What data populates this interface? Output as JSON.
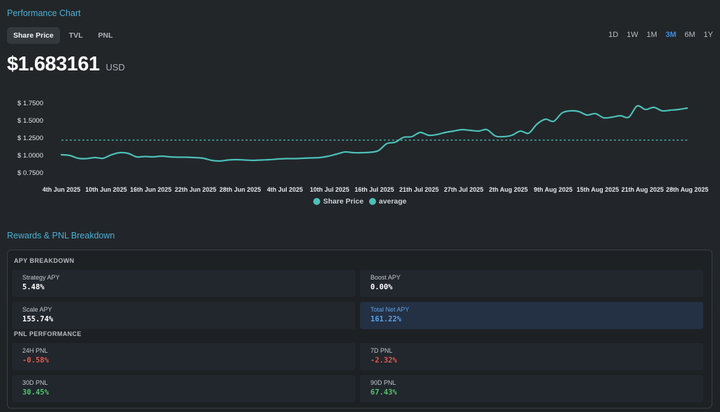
{
  "header": {
    "performance_title": "Performance Chart",
    "tabs": [
      {
        "label": "Share Price",
        "active": true
      },
      {
        "label": "TVL",
        "active": false
      },
      {
        "label": "PNL",
        "active": false
      }
    ],
    "ranges": [
      {
        "label": "1D",
        "active": false
      },
      {
        "label": "1W",
        "active": false
      },
      {
        "label": "1M",
        "active": false
      },
      {
        "label": "3M",
        "active": true
      },
      {
        "label": "6M",
        "active": false
      },
      {
        "label": "1Y",
        "active": false
      }
    ],
    "price_value": "$1.683161",
    "price_unit": "USD"
  },
  "chart_data": {
    "type": "line",
    "y_ticks": [
      "$ 1.7500",
      "$ 1.5000",
      "$ 1.2500",
      "$ 1.0000",
      "$ 0.7500"
    ],
    "y_tick_values": [
      1.75,
      1.5,
      1.25,
      1.0,
      0.75
    ],
    "x_ticks": [
      "4th Jun 2025",
      "10th Jun 2025",
      "16th Jun 2025",
      "22th Jun 2025",
      "28th Jun 2025",
      "4th Jul 2025",
      "10th Jul 2025",
      "16th Jul 2025",
      "21th Jul 2025",
      "27th Jul 2025",
      "2th Aug 2025",
      "9th Aug 2025",
      "15th Aug 2025",
      "21th Aug 2025",
      "28th Aug 2025"
    ],
    "series": [
      {
        "name": "Share Price",
        "color": "#4cc0b8",
        "values": [
          1.01,
          1.0,
          0.96,
          0.955,
          0.97,
          0.96,
          1.01,
          1.04,
          1.03,
          0.98,
          0.985,
          0.98,
          0.99,
          0.98,
          0.975,
          0.975,
          0.97,
          0.96,
          0.93,
          0.92,
          0.935,
          0.94,
          0.935,
          0.93,
          0.935,
          0.94,
          0.95,
          0.955,
          0.955,
          0.96,
          0.965,
          0.97,
          0.99,
          1.02,
          1.05,
          1.04,
          1.04,
          1.045,
          1.07,
          1.17,
          1.19,
          1.26,
          1.27,
          1.33,
          1.29,
          1.3,
          1.33,
          1.35,
          1.37,
          1.36,
          1.35,
          1.37,
          1.28,
          1.27,
          1.29,
          1.35,
          1.32,
          1.45,
          1.52,
          1.49,
          1.61,
          1.64,
          1.63,
          1.58,
          1.6,
          1.54,
          1.55,
          1.57,
          1.55,
          1.71,
          1.66,
          1.69,
          1.64,
          1.65,
          1.66,
          1.68
        ]
      },
      {
        "name": "average",
        "color": "#4cc0b8",
        "values": [
          1.22,
          1.22
        ]
      }
    ]
  },
  "rewards": {
    "title": "Rewards & PNL Breakdown",
    "apy_label": "APY BREAKDOWN",
    "strategy_label": "Strategy APY",
    "strategy_value": "5.48%",
    "boost_label": "Boost APY",
    "boost_value": "0.00%",
    "scale_label": "Scale APY",
    "scale_value": "155.74%",
    "total_label": "Total Net APY",
    "total_value": "161.22%",
    "pnl_label": "PNL PERFORMANCE",
    "pnl24_label": "24H PNL",
    "pnl24_value": "-0.58%",
    "pnl7_label": "7D PNL",
    "pnl7_value": "-2.32%",
    "pnl30_label": "30D PNL",
    "pnl30_value": "30.45%",
    "pnl90_label": "90D PNL",
    "pnl90_value": "67.43%"
  }
}
